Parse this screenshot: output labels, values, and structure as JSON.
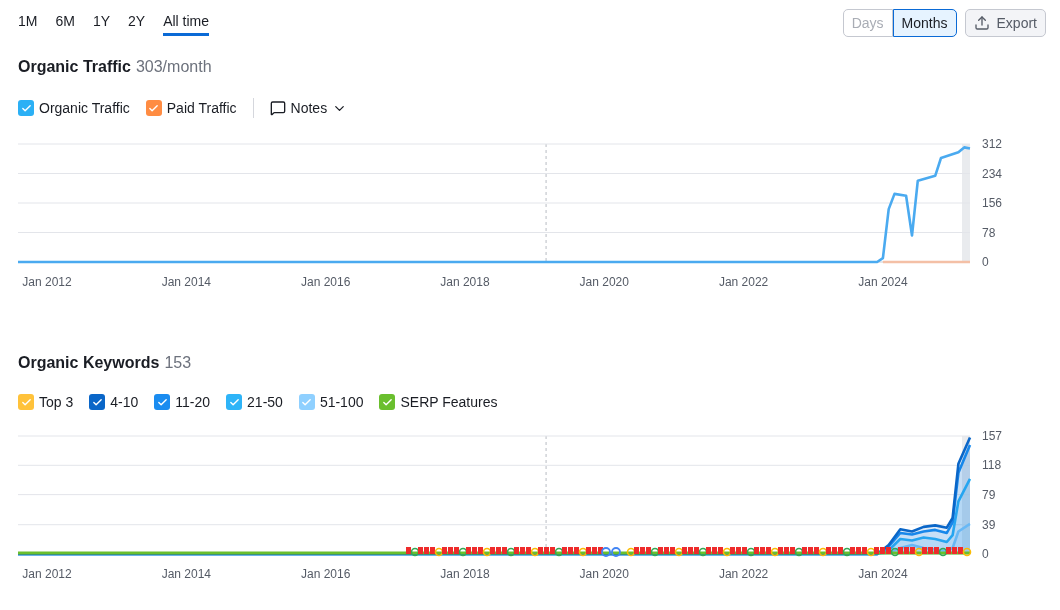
{
  "periods": [
    {
      "label": "1M",
      "selected": false
    },
    {
      "label": "6M",
      "selected": false
    },
    {
      "label": "1Y",
      "selected": false
    },
    {
      "label": "2Y",
      "selected": false
    },
    {
      "label": "All time",
      "selected": true
    }
  ],
  "granularity": [
    {
      "label": "Days",
      "selected": false,
      "disabled": true
    },
    {
      "label": "Months",
      "selected": true,
      "disabled": false
    }
  ],
  "export_button": {
    "label": "Export"
  },
  "sections": [
    {
      "title": "Organic Traffic",
      "value": "303/month",
      "legend": [
        {
          "label": "Organic Traffic",
          "checked": true,
          "color": "#2bb0f5"
        },
        {
          "label": "Paid Traffic",
          "checked": true,
          "color": "#ff8c42"
        }
      ],
      "notes_button": {
        "label": "Notes"
      },
      "chart_data": {
        "type": "line",
        "x": [
          "2011-08",
          "2023-12",
          "2024-01",
          "2024-02",
          "2024-03",
          "2024-05",
          "2024-06",
          "2024-07",
          "2024-10",
          "2024-11",
          "2025-02",
          "2025-03",
          "2025-04"
        ],
        "series": [
          {
            "color": "#4aaaf0",
            "values": [
              0,
              0,
              10,
              140,
              180,
              175,
              70,
              215,
              228,
              275,
              290,
              303,
              300
            ]
          },
          {
            "color": "#f4c0a6",
            "values": [
              null,
              null,
              0,
              0,
              0,
              0,
              0,
              0,
              0,
              0,
              0,
              0,
              0
            ]
          }
        ],
        "xlim": [
          "2011-08",
          "2025-04"
        ],
        "ylim": [
          0,
          312
        ],
        "xticks": [
          {
            "value": "2012-01",
            "label": "Jan 2012"
          },
          {
            "value": "2014-01",
            "label": "Jan 2014"
          },
          {
            "value": "2016-01",
            "label": "Jan 2016"
          },
          {
            "value": "2018-01",
            "label": "Jan 2018"
          },
          {
            "value": "2020-01",
            "label": "Jan 2020"
          },
          {
            "value": "2022-01",
            "label": "Jan 2022"
          },
          {
            "value": "2024-01",
            "label": "Jan 2024"
          }
        ],
        "yticks": [
          0,
          78,
          156,
          234,
          312
        ],
        "grid": true
      }
    },
    {
      "title": "Organic Keywords",
      "value": "153",
      "legend": [
        {
          "label": "Top 3",
          "checked": true,
          "color": "#ffc23a"
        },
        {
          "label": "4-10",
          "checked": true,
          "color": "#0a66c8"
        },
        {
          "label": "11-20",
          "checked": true,
          "color": "#1a8cf0"
        },
        {
          "label": "21-50",
          "checked": true,
          "color": "#2eb4f8"
        },
        {
          "label": "51-100",
          "checked": true,
          "color": "#8fd0ff"
        },
        {
          "label": "SERP Features",
          "checked": true,
          "color": "#6abf2e"
        }
      ],
      "chart_data": {
        "type": "area",
        "x": [
          "2011-08",
          "2023-12",
          "2024-02",
          "2024-04",
          "2024-06",
          "2024-08",
          "2024-10",
          "2024-12",
          "2025-01",
          "2025-02",
          "2025-04"
        ],
        "series": [
          {
            "color": "#0a66c8",
            "values": [
              0,
              0,
              12,
              33,
              30,
              36,
              38,
              35,
              48,
              120,
              155
            ]
          },
          {
            "color": "#1a8cf0",
            "values": [
              0,
              0,
              10,
              28,
              26,
              30,
              32,
              28,
              42,
              108,
              145
            ]
          },
          {
            "color": "#2eb4f8",
            "values": [
              0,
              0,
              5,
              20,
              18,
              22,
              20,
              16,
              25,
              70,
              100
            ]
          },
          {
            "color": "#8fd0ff",
            "values": [
              0,
              0,
              2,
              8,
              12,
              8,
              6,
              4,
              8,
              30,
              40
            ]
          }
        ],
        "xlim": [
          "2011-08",
          "2025-04"
        ],
        "ylim": [
          0,
          157
        ],
        "xticks": [
          {
            "value": "2012-01",
            "label": "Jan 2012"
          },
          {
            "value": "2014-01",
            "label": "Jan 2014"
          },
          {
            "value": "2016-01",
            "label": "Jan 2016"
          },
          {
            "value": "2018-01",
            "label": "Jan 2018"
          },
          {
            "value": "2020-01",
            "label": "Jan 2020"
          },
          {
            "value": "2022-01",
            "label": "Jan 2022"
          },
          {
            "value": "2024-01",
            "label": "Jan 2024"
          }
        ],
        "yticks": [
          0,
          39,
          79,
          118,
          157
        ],
        "grid": true
      }
    }
  ]
}
